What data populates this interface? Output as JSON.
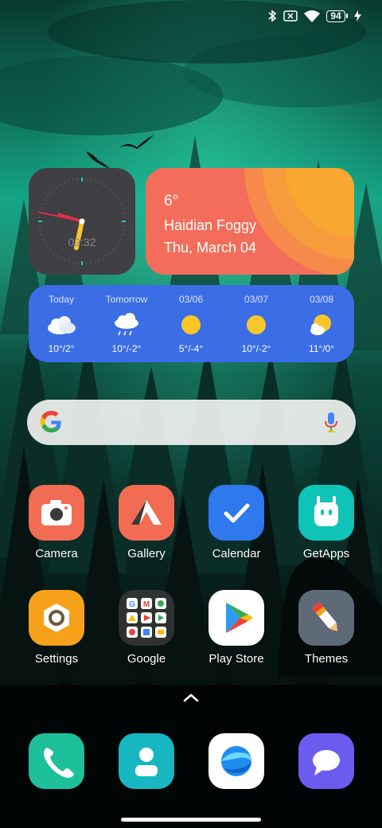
{
  "status_bar": {
    "battery_level": "94",
    "icons": [
      "bluetooth-icon",
      "no-sim-icon",
      "wifi-icon",
      "battery-icon",
      "charging-bolt-icon"
    ]
  },
  "clock_widget": {
    "digital_time": "09:32",
    "hour": 9,
    "minute": 32,
    "second": 47
  },
  "weather_widget": {
    "temperature": "6°",
    "location_condition": "Haidian Foggy",
    "date": "Thu, March 04",
    "background_color": "#f36d5a",
    "sun_color": "#f7a830"
  },
  "forecast_widget": {
    "background_color": "#3a6de6",
    "days": [
      {
        "label": "Today",
        "icon": "cloudy-icon",
        "temp": "10°/2°"
      },
      {
        "label": "Tomorrow",
        "icon": "rain-icon",
        "temp": "10°/-2°"
      },
      {
        "label": "03/06",
        "icon": "sunny-icon",
        "temp": "5°/-4°"
      },
      {
        "label": "03/07",
        "icon": "sunny-icon",
        "temp": "10°/-2°"
      },
      {
        "label": "03/08",
        "icon": "partly-cloudy-icon",
        "temp": "11°/0°"
      }
    ]
  },
  "search_bar": {
    "icons": [
      "google-g-icon",
      "microphone-icon"
    ]
  },
  "apps": {
    "row1": [
      {
        "label": "Camera",
        "icon": "camera-icon",
        "color": "#f26b53"
      },
      {
        "label": "Gallery",
        "icon": "gallery-icon",
        "color": "#f26b53"
      },
      {
        "label": "Calendar",
        "icon": "calendar-check-icon",
        "color": "#2f78ee"
      },
      {
        "label": "GetApps",
        "icon": "getapps-robot-icon",
        "color": "#10c3b7"
      }
    ],
    "row2": [
      {
        "label": "Settings",
        "icon": "settings-hexagon-icon",
        "color": "#f7a11a"
      },
      {
        "label": "Google",
        "icon": "google-folder-icon",
        "color": "#333333"
      },
      {
        "label": "Play Store",
        "icon": "play-store-icon",
        "color": "#ffffff"
      },
      {
        "label": "Themes",
        "icon": "themes-brush-icon",
        "color": "#5f6a78"
      }
    ]
  },
  "dock": [
    {
      "icon": "phone-icon",
      "color": "#1ebf9b"
    },
    {
      "icon": "contacts-icon",
      "color": "#16b7c0"
    },
    {
      "icon": "browser-icon",
      "color": "#ffffff"
    },
    {
      "icon": "messages-icon",
      "color": "#6b5cf0"
    }
  ]
}
